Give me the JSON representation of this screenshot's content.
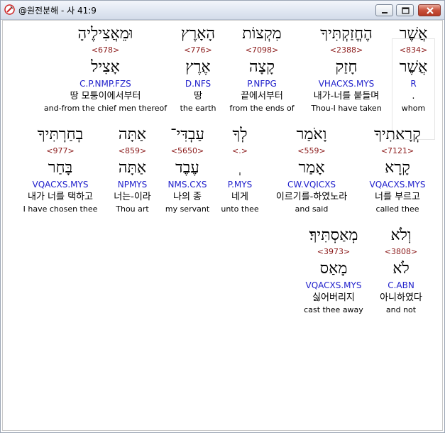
{
  "window": {
    "title": "@원전분해 - 사 41:9",
    "buttons": {
      "minimize": "minimize",
      "maximize": "maximize",
      "close": "close"
    }
  },
  "rows": [
    {
      "words": [
        {
          "heb": "אֲשֶׁר",
          "num": "<834>",
          "lemma": "אֲשֶׁר",
          "morph": "R",
          "kor": ".",
          "eng": "whom",
          "selected": true
        },
        {
          "heb": "הֶחֱזַקְתִּיךָ",
          "num": "<2388>",
          "lemma": "חָזַק",
          "morph": "VHACXS.MYS",
          "kor": "내가-너를 붙들며",
          "eng": "Thou-I have taken"
        },
        {
          "heb": "מִקְצוֹת",
          "num": "<7098>",
          "lemma": "קָצָה",
          "morph": "P.NFPG",
          "kor": "끝에서부터",
          "eng": "from the ends of"
        },
        {
          "heb": "הָאָרֶץ",
          "num": "<776>",
          "lemma": "אֶרֶץ",
          "morph": "D.NFS",
          "kor": "땅",
          "eng": "the earth"
        },
        {
          "heb": "וּמֵאֲצִילֶיהָ",
          "num": "<678>",
          "lemma": "אָצִיל",
          "morph": "C.P.NMP.FZS",
          "kor": "땅 모퉁이에서부터",
          "eng": "and-from the chief men thereof"
        }
      ]
    },
    {
      "words": [
        {
          "heb": "קְרָאתִיךָ",
          "num": "<7121>",
          "lemma": "קָרָא",
          "morph": "VQACXS.MYS",
          "kor": "너를 부르고",
          "eng": "called thee"
        },
        {
          "heb": "וָאֹמַר",
          "num": "<559>",
          "lemma": "אָמַר",
          "morph": "CW.VQICXS",
          "kor": "이르기를-하였노라",
          "eng": "and said"
        },
        {
          "heb": "לְךָ",
          "num": "<.>",
          "lemma": "ְ",
          "morph": "P.MYS",
          "kor": "네게",
          "eng": "unto thee"
        },
        {
          "heb": "עַבְדִּי־",
          "num": "<5650>",
          "lemma": "עֶבֶד",
          "morph": "NMS.CXS",
          "kor": "나의 종",
          "eng": "my servant"
        },
        {
          "heb": "אַתָּה",
          "num": "<859>",
          "lemma": "אַתָּה",
          "morph": "NPMYS",
          "kor": "너는-이라",
          "eng": "Thou art"
        },
        {
          "heb": "בְחַרְתִּיךָ",
          "num": "<977>",
          "lemma": "בָּחַר",
          "morph": "VQACXS.MYS",
          "kor": "내가 너를 택하고",
          "eng": "I have chosen thee"
        }
      ]
    },
    {
      "words": [
        {
          "heb": "וְלֹא",
          "num": "<3808>",
          "lemma": "לֹא",
          "morph": "C.ABN",
          "kor": "아니하였다",
          "eng": "and not"
        },
        {
          "heb": "מְאַסְתִּיךָ׃",
          "num": "<3973>",
          "lemma": "מָאַס",
          "morph": "VQACXS.MYS",
          "kor": "싫어버리지",
          "eng": "cast thee away"
        }
      ]
    }
  ]
}
